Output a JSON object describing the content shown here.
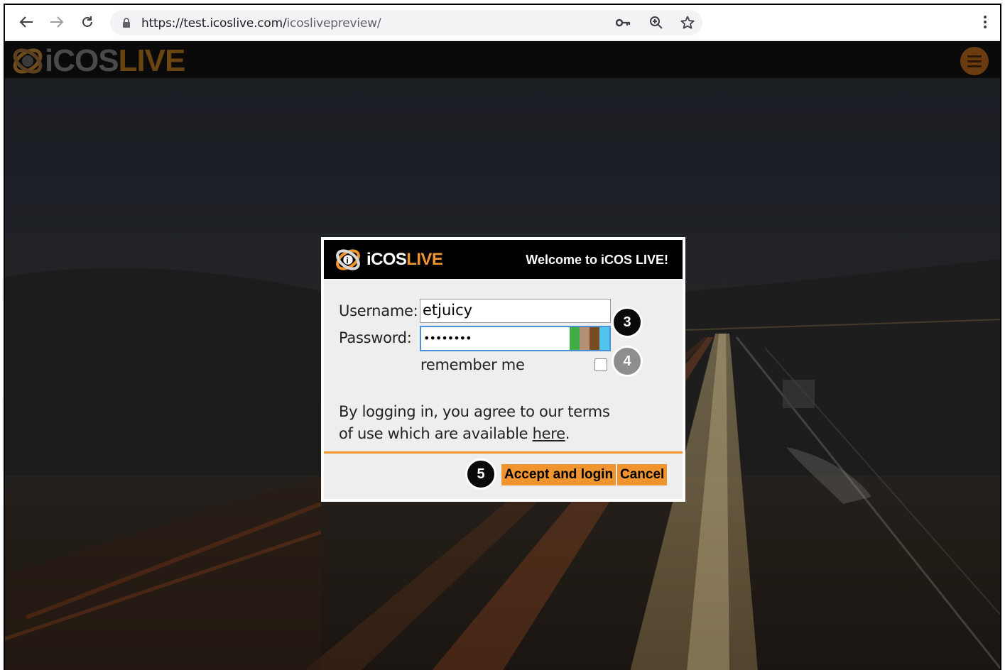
{
  "browser": {
    "url_host": "https://test.icoslive.com/",
    "url_path": "icoslivepreview/",
    "icons": [
      "back-icon",
      "forward-icon",
      "reload-icon",
      "lock-icon",
      "key-icon",
      "zoom-icon",
      "star-icon",
      "kebab-menu-icon"
    ]
  },
  "header": {
    "brand_prefix": "iCOS",
    "brand_suffix": "LIVE",
    "menu_icon": "hamburger-icon"
  },
  "dialog": {
    "brand_prefix": "iCOS",
    "brand_suffix": "LIVE",
    "title": "Welcome to iCOS LIVE!",
    "username_label": "Username:",
    "username_value": "etjuicy",
    "password_label": "Password:",
    "password_value": "••••••••",
    "remember_label": "remember me",
    "remember_checked": false,
    "terms_line1": "By logging in, you agree to our terms",
    "terms_line2_prefix": "of use which are available ",
    "terms_link": "here",
    "terms_suffix": ".",
    "accept_button": "Accept and login",
    "cancel_button": "Cancel"
  },
  "annotations": {
    "step3": "3",
    "step4": "4",
    "step5": "5"
  },
  "colors": {
    "accent": "#f0942f",
    "brand_dark_orange": "#8a5a1f",
    "dialog_bg": "#eeeeee"
  }
}
